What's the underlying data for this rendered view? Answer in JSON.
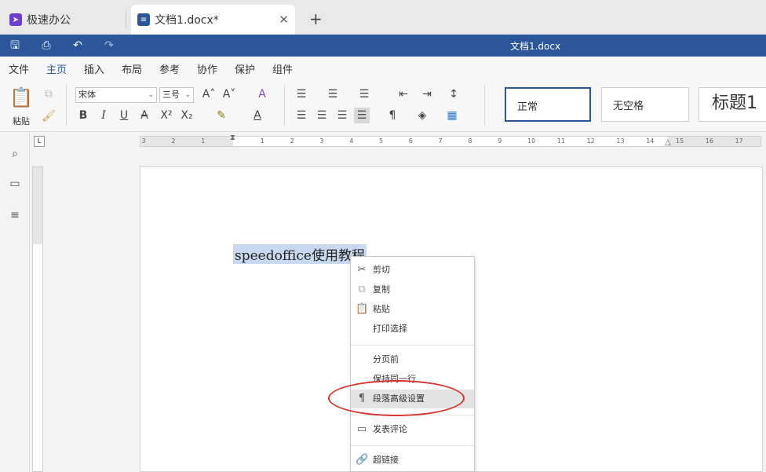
{
  "tabs": [
    {
      "label": "极速办公",
      "active": false
    },
    {
      "label": "文档1.docx*",
      "active": true
    }
  ],
  "titlebar": {
    "title": "文档1.docx"
  },
  "menu": {
    "items": [
      "文件",
      "主页",
      "插入",
      "布局",
      "参考",
      "协作",
      "保护",
      "组件"
    ],
    "active": "主页"
  },
  "ribbon": {
    "paste_label": "粘贴",
    "font_name": "宋体",
    "font_size": "三号",
    "styles": [
      "正常",
      "无空格",
      "标题1"
    ]
  },
  "ruler": {
    "h_ticks": [
      "3",
      "2",
      "1",
      "1",
      "2",
      "3",
      "4",
      "5",
      "6",
      "7",
      "8",
      "9",
      "10",
      "11",
      "12",
      "13",
      "14",
      "15",
      "16",
      "17"
    ]
  },
  "document": {
    "text": "speedoffice使用教程"
  },
  "context_menu": {
    "items": [
      {
        "label": "剪切",
        "icon": "scissors-icon"
      },
      {
        "label": "复制",
        "icon": "copy-icon"
      },
      {
        "label": "粘贴",
        "icon": "paste-icon"
      },
      {
        "label": "打印选择",
        "icon": ""
      },
      {
        "label": "分页前",
        "icon": ""
      },
      {
        "label": "保持同一行",
        "icon": ""
      },
      {
        "label": "段落高级设置",
        "icon": "pilcrow-icon",
        "highlighted": true
      },
      {
        "label": "发表评论",
        "icon": "comment-icon"
      },
      {
        "label": "超链接",
        "icon": "link-icon"
      }
    ]
  },
  "colors": {
    "accent": "#2b579a",
    "selection": "#c7d9ef",
    "annotation": "#d9342b"
  }
}
